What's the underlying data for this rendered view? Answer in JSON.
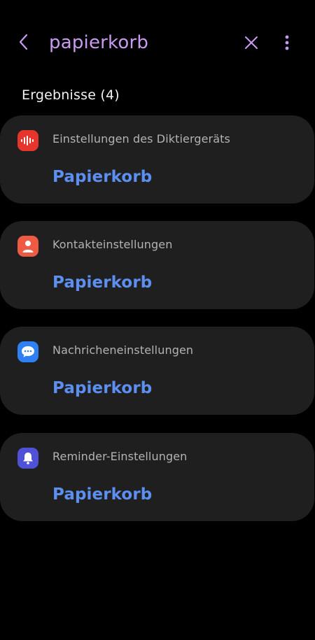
{
  "search": {
    "query": "papierkorb"
  },
  "header_icons": {
    "back": "chevron-left-icon",
    "clear": "close-icon",
    "more": "more-vertical-icon",
    "icon_color": "#c99bf0"
  },
  "results": {
    "heading": "Ergebnisse (4)"
  },
  "cards": [
    {
      "category": "Einstellungen des Diktiergeräts",
      "result": "Papierkorb",
      "icon": "voice-recorder-icon",
      "icon_color": "#e5352c"
    },
    {
      "category": "Kontakteinstellungen",
      "result": "Papierkorb",
      "icon": "contact-person-icon",
      "icon_color": "#ef5a45"
    },
    {
      "category": "Nachricheneinstellungen",
      "result": "Papierkorb",
      "icon": "message-bubble-icon",
      "icon_color": "#2f7ff5"
    },
    {
      "category": "Reminder-Einstellungen",
      "result": "Papierkorb",
      "icon": "bell-icon",
      "icon_color": "#4f51d6"
    }
  ],
  "colors": {
    "background": "#000000",
    "card_background": "#1f1f1f",
    "result_text": "#5c8ff0",
    "category_text": "#b3b3b3"
  }
}
